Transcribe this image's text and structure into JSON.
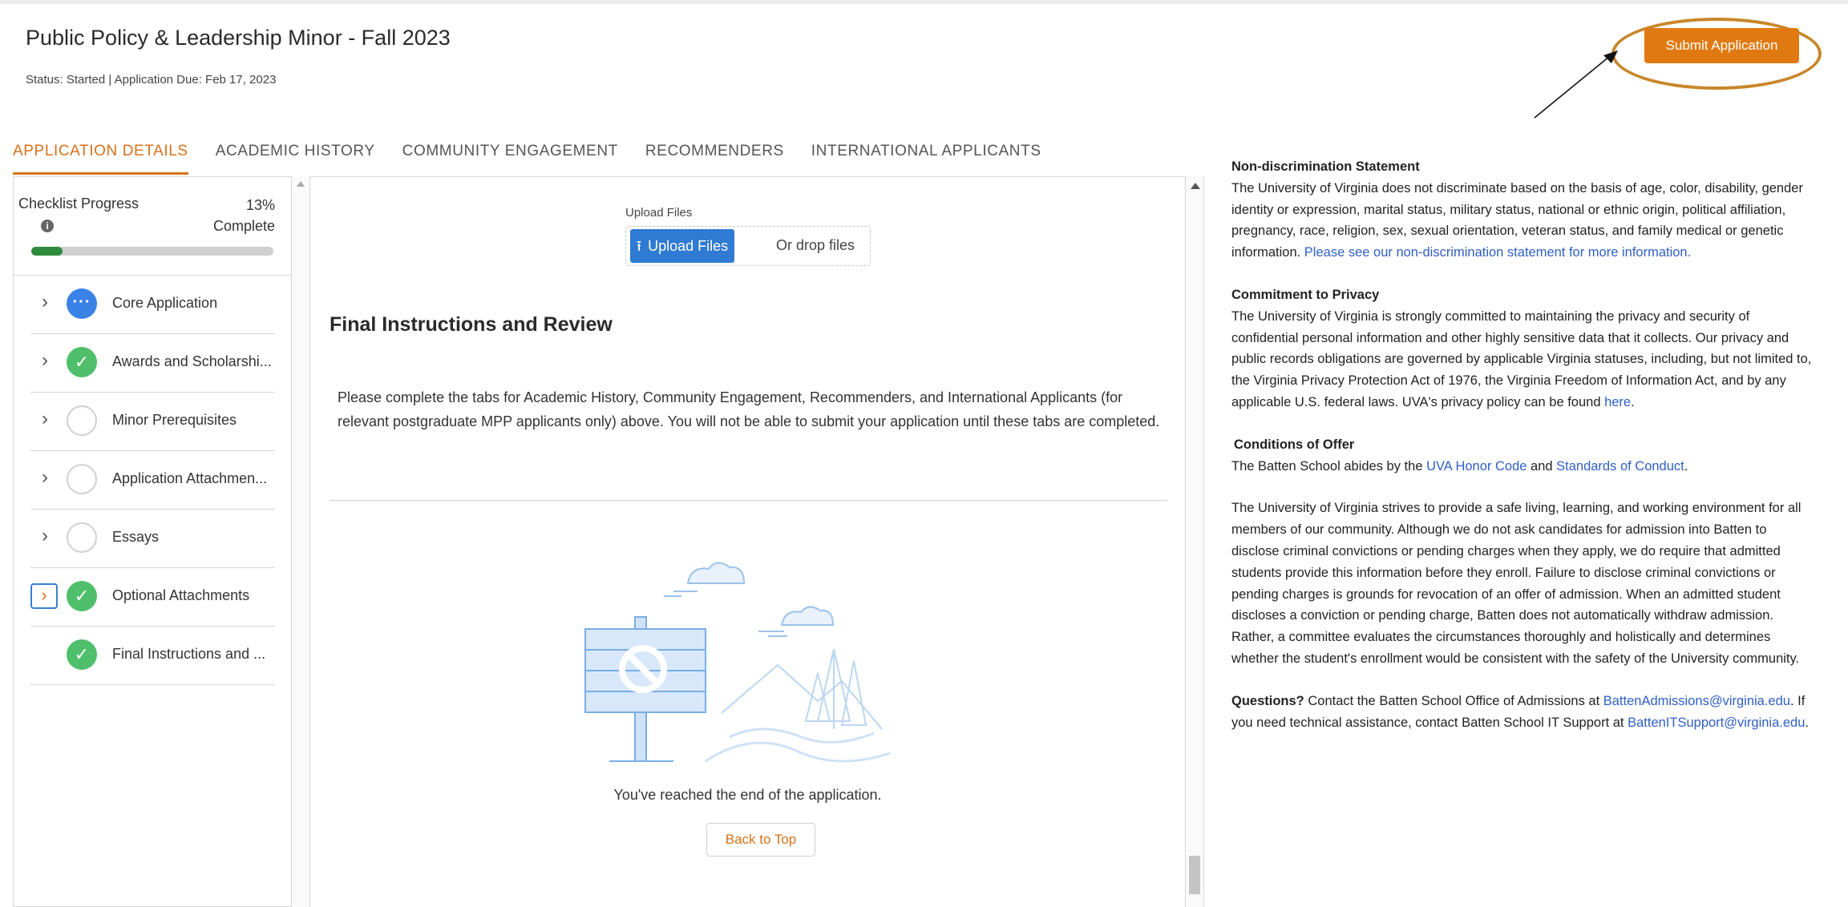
{
  "header": {
    "title": "Public Policy & Leadership Minor - Fall 2023",
    "status": "Status: Started | Application Due: Feb 17, 2023",
    "submit_label": "Submit Application"
  },
  "tabs": [
    {
      "label": "APPLICATION DETAILS",
      "active": true
    },
    {
      "label": "ACADEMIC HISTORY",
      "active": false
    },
    {
      "label": "COMMUNITY ENGAGEMENT",
      "active": false
    },
    {
      "label": "RECOMMENDERS",
      "active": false
    },
    {
      "label": "INTERNATIONAL APPLICANTS",
      "active": false
    }
  ],
  "checklist": {
    "label": "Checklist Progress",
    "percent_text": "13%",
    "complete_text": "Complete",
    "progress_fraction": 0.13,
    "info_icon": "info-icon",
    "steps": [
      {
        "label": "Core Application",
        "state": "in-progress",
        "chevron": true
      },
      {
        "label": "Awards and Scholarshi...",
        "state": "complete",
        "chevron": true
      },
      {
        "label": "Minor Prerequisites",
        "state": "not-started",
        "chevron": true
      },
      {
        "label": "Application Attachmen...",
        "state": "not-started",
        "chevron": true
      },
      {
        "label": "Essays",
        "state": "not-started",
        "chevron": true
      },
      {
        "label": "Optional Attachments",
        "state": "complete",
        "chevron": true,
        "focused": true
      },
      {
        "label": "Final Instructions and ...",
        "state": "complete",
        "chevron": false
      }
    ]
  },
  "upload": {
    "label": "Upload Files",
    "button_label": "Upload Files",
    "drop_text": "Or drop files"
  },
  "final_section": {
    "title": "Final Instructions and Review",
    "instructions": "Please complete the tabs for Academic History, Community Engagement, Recommenders, and International Applicants (for relevant postgraduate MPP applicants only) above. You will not be able to submit your application until these tabs are completed.",
    "end_text": "You've reached the end of the application.",
    "back_to_top": "Back to Top"
  },
  "right_panel": {
    "nondiscrimination": {
      "heading": "Non-discrimination Statement",
      "text": "The University of Virginia does not discriminate based on the basis of age, color, disability, gender identity or expression, marital status, military status, national or ethnic origin, political affiliation, pregnancy, race, religion, sex, sexual orientation, veteran status, and family medical or genetic information. ",
      "link": "Please see our non-discrimination statement for more information."
    },
    "privacy": {
      "heading": "Commitment to Privacy",
      "text": "The University of Virginia is strongly committed to maintaining the privacy and security of confidential personal information and other highly sensitive data that it collects.  Our privacy and public records obligations are governed by applicable Virginia statuses, including, but not limited to, the Virginia Privacy Protection Act of 1976, the Virginia Freedom of Information Act, and by any applicable U.S. federal laws.  UVA's privacy policy can be found ",
      "link": "here",
      "end": "."
    },
    "offer": {
      "heading": "Conditions of Offer",
      "text_before": "The Batten School abides by the ",
      "link1": "UVA Honor Code",
      "text_mid": " and ",
      "link2": "Standards of Conduct",
      "text_end": "."
    },
    "environment": "The University of Virginia strives to provide a safe living, learning, and working environment for all members of our community.  Although we do not ask candidates for admission into Batten to disclose criminal convictions or pending charges when they apply, we do require that admitted students provide this information before they enroll. Failure to disclose criminal convictions or pending charges is grounds for revocation of an offer of admission. When an admitted student discloses a conviction or pending charge, Batten does not automatically withdraw admission. Rather, a committee evaluates the circumstances thoroughly and holistically and determines whether the student's enrollment would be consistent with the safety of the University community.",
    "questions": {
      "heading": "Questions?",
      "text1": " Contact the Batten School Office of Admissions at ",
      "email1": "BattenAdmissions@virginia.edu",
      "text2": ".  If you need technical assistance, contact Batten School IT Support at ",
      "email2": "BattenITSupport@virginia.edu",
      "text3": "."
    }
  },
  "colors": {
    "accent_orange": "#e07a10",
    "link_blue": "#2f5fc7",
    "complete_green": "#4fbf6b",
    "in_progress_blue": "#3b82e6",
    "progress_bar_green": "#2e8b3e"
  }
}
